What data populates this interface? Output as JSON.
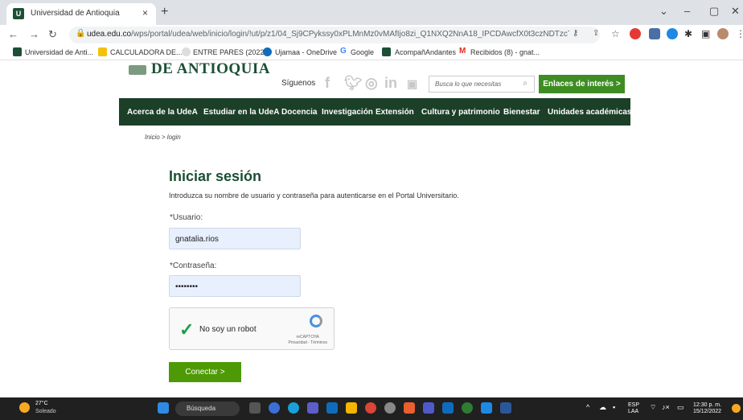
{
  "browser": {
    "tab_title": "Universidad de Antioquia",
    "tab_close": "×",
    "new_tab": "+",
    "url_domain": "udea.edu.co",
    "url_path": "/wps/portal/udea/web/inicio/login/!ut/p/z1/04_Sj9CPykssy0xPLMnMz0vMAfIjo8zi_Q1NXQ2NnA18_IPCDAwcfX0t3czNDTzcTEz1ww...",
    "bookmarks": [
      "Universidad de Anti...",
      "CALCULADORA DE...",
      "ENTRE PARES (2022...",
      "Ujamaa - OneDrive",
      "Google",
      "AcompañAndantes",
      "Recibidos (8) - gnat..."
    ]
  },
  "site": {
    "logo_text": "DE ANTIOQUIA",
    "siguenos": "Síguenos",
    "search_placeholder": "Busca lo que necesitas",
    "enlaces_button": "Enlaces de interés  >",
    "menu": [
      "Acerca de la UdeA",
      "Estudiar en la UdeA",
      "Docencia",
      "Investigación",
      "Extensión",
      "Cultura y patrimonio",
      "Bienestar",
      "Unidades académicas"
    ],
    "breadcrumb": "Inicio > login"
  },
  "login": {
    "title": "Iniciar sesión",
    "intro": "Introduzca su nombre de usuario y contraseña para autenticarse en el Portal Universitario.",
    "user_label": "*Usuario:",
    "user_value": "gnatalia.rios",
    "password_label": "*Contraseña:",
    "password_value": "••••••••",
    "captcha_text": "No soy un robot",
    "captcha_brand": "reCAPTCHA",
    "captcha_links": "Privacidad - Términos",
    "submit": "Conectar  >"
  },
  "taskbar": {
    "temp": "27°C",
    "weather": "Soleado",
    "search": "Búsqueda",
    "lang1": "ESP",
    "lang2": "LAA",
    "time": "12:30 p. m.",
    "date": "15/12/2022"
  },
  "colors": {
    "brand_green": "#1c4f35",
    "button_green": "#4e9a06",
    "menu_bg": "#1c3f28"
  }
}
